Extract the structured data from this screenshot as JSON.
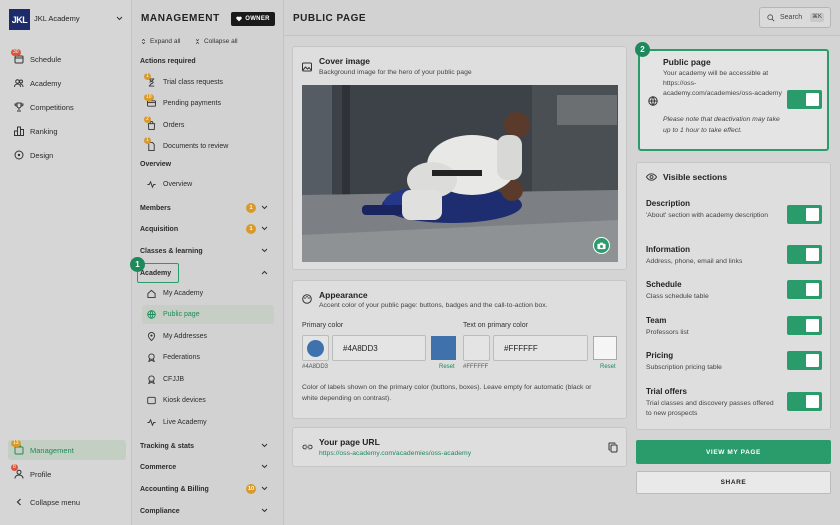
{
  "app": {
    "academy_name": "JKL Academy",
    "logo_text": "JKL"
  },
  "left_nav": {
    "items": [
      {
        "label": "Schedule",
        "badge": "30"
      },
      {
        "label": "Academy"
      },
      {
        "label": "Competitions"
      },
      {
        "label": "Ranking"
      },
      {
        "label": "Design"
      }
    ],
    "management": {
      "label": "Management",
      "badge": "13"
    },
    "profile": {
      "label": "Profile",
      "badge": "8"
    },
    "collapse_label": "Collapse menu"
  },
  "mid_nav": {
    "title": "MANAGEMENT",
    "owner_tag": "OWNER",
    "expand_all": "Expand all",
    "collapse_all": "Collapse all",
    "actions_required": {
      "heading": "Actions required",
      "items": [
        {
          "label": "Trial class requests",
          "badge": "1"
        },
        {
          "label": "Pending payments",
          "badge": "10"
        },
        {
          "label": "Orders",
          "badge": "2"
        },
        {
          "label": "Documents to review",
          "badge": "1"
        }
      ]
    },
    "overview": {
      "heading": "Overview",
      "item": "Overview"
    },
    "groups": {
      "members": {
        "label": "Members",
        "badge": "1"
      },
      "acquisition": {
        "label": "Acquisition",
        "badge": "1"
      },
      "classes": {
        "label": "Classes & learning"
      },
      "academy": {
        "label": "Academy"
      },
      "tracking": {
        "label": "Tracking & stats"
      },
      "commerce": {
        "label": "Commerce"
      },
      "accounting": {
        "label": "Accounting & Billing",
        "badge": "10"
      },
      "compliance": {
        "label": "Compliance"
      }
    },
    "academy_items": [
      {
        "label": "My Academy"
      },
      {
        "label": "Public page"
      },
      {
        "label": "My Addresses"
      },
      {
        "label": "Federations"
      },
      {
        "label": "CFJJB"
      },
      {
        "label": "Kiosk devices"
      },
      {
        "label": "Live Academy"
      }
    ]
  },
  "topbar": {
    "page_title": "PUBLIC PAGE",
    "search_label": "Search",
    "shortcut": "⌘K"
  },
  "cover": {
    "title": "Cover image",
    "description": "Background image for the hero of your public page"
  },
  "appearance": {
    "title": "Appearance",
    "description": "Accent color of your public page: buttons, badges and the call-to-action box.",
    "primary_label": "Primary color",
    "primary_value": "#4A8DD3",
    "primary_hint": "#4A8DD3",
    "primary_reset": "Reset",
    "text_label": "Text on primary color",
    "text_value": "#FFFFFF",
    "text_hint": "#FFFFFF",
    "text_reset": "Reset",
    "note": "Color of labels shown on the primary color (buttons, boxes). Leave empty for automatic (black or white depending on contrast).",
    "colors": {
      "primary_swatch": "#3f72ad",
      "accent": "#2a9b6b"
    }
  },
  "page_url": {
    "title": "Your page URL",
    "url": "https://oss-academy.com/academies/oss-academy"
  },
  "public_page": {
    "title": "Public page",
    "description": "Your academy will be accessible at https://oss-academy.com/academies/oss-academy",
    "note": "Please note that deactivation may take up to 1 hour to take effect.",
    "enabled": true
  },
  "visible_sections": {
    "title": "Visible sections",
    "items": [
      {
        "title": "Description",
        "desc": "'About' section with academy description",
        "enabled": true
      },
      {
        "title": "Information",
        "desc": "Address, phone, email and links",
        "enabled": true
      },
      {
        "title": "Schedule",
        "desc": "Class schedule table",
        "enabled": true
      },
      {
        "title": "Team",
        "desc": "Professors list",
        "enabled": true
      },
      {
        "title": "Pricing",
        "desc": "Subscription pricing table",
        "enabled": true
      },
      {
        "title": "Trial offers",
        "desc": "Trial classes and discovery passes offered to new prospects",
        "enabled": true
      }
    ]
  },
  "buttons": {
    "view": "VIEW MY PAGE",
    "share": "SHARE"
  },
  "steps": {
    "one": "1",
    "two": "2"
  }
}
